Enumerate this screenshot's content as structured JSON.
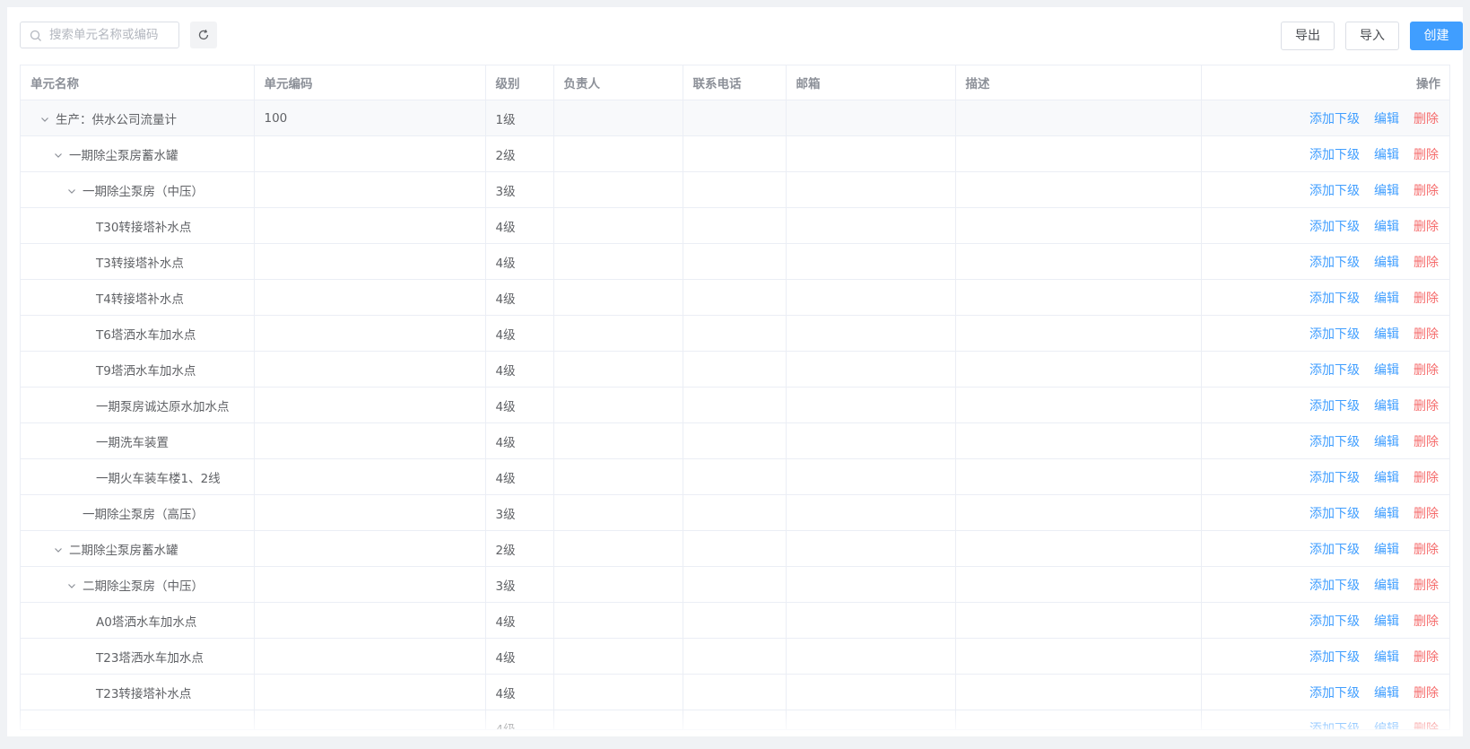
{
  "toolbar": {
    "search_placeholder": "搜索单元名称或编码",
    "export_label": "导出",
    "import_label": "导入",
    "create_label": "创建"
  },
  "table": {
    "columns": [
      "单元名称",
      "单元编码",
      "级别",
      "负责人",
      "联系电话",
      "邮箱",
      "描述",
      "操作"
    ],
    "actions": {
      "add_child": "添加下级",
      "edit": "编辑",
      "delete": "删除"
    },
    "rows": [
      {
        "name": "生产：供水公司流量计",
        "code": "100",
        "level": "1级",
        "depth": 0,
        "expandable": true
      },
      {
        "name": "一期除尘泵房蓄水罐",
        "code": "",
        "level": "2级",
        "depth": 1,
        "expandable": true
      },
      {
        "name": "一期除尘泵房（中压）",
        "code": "",
        "level": "3级",
        "depth": 2,
        "expandable": true
      },
      {
        "name": "T30转接塔补水点",
        "code": "",
        "level": "4级",
        "depth": 3,
        "expandable": false
      },
      {
        "name": "T3转接塔补水点",
        "code": "",
        "level": "4级",
        "depth": 3,
        "expandable": false
      },
      {
        "name": "T4转接塔补水点",
        "code": "",
        "level": "4级",
        "depth": 3,
        "expandable": false
      },
      {
        "name": "T6塔洒水车加水点",
        "code": "",
        "level": "4级",
        "depth": 3,
        "expandable": false
      },
      {
        "name": "T9塔洒水车加水点",
        "code": "",
        "level": "4级",
        "depth": 3,
        "expandable": false
      },
      {
        "name": "一期泵房诚达原水加水点",
        "code": "",
        "level": "4级",
        "depth": 3,
        "expandable": false
      },
      {
        "name": "一期洗车装置",
        "code": "",
        "level": "4级",
        "depth": 3,
        "expandable": false
      },
      {
        "name": "一期火车装车楼1、2线",
        "code": "",
        "level": "4级",
        "depth": 3,
        "expandable": false
      },
      {
        "name": "一期除尘泵房（高压）",
        "code": "",
        "level": "3级",
        "depth": 2,
        "expandable": false
      },
      {
        "name": "二期除尘泵房蓄水罐",
        "code": "",
        "level": "2级",
        "depth": 1,
        "expandable": true
      },
      {
        "name": "二期除尘泵房（中压）",
        "code": "",
        "level": "3级",
        "depth": 2,
        "expandable": true
      },
      {
        "name": "A0塔洒水车加水点",
        "code": "",
        "level": "4级",
        "depth": 3,
        "expandable": false
      },
      {
        "name": "T23塔洒水车加水点",
        "code": "",
        "level": "4级",
        "depth": 3,
        "expandable": false
      },
      {
        "name": "T23转接塔补水点",
        "code": "",
        "level": "4级",
        "depth": 3,
        "expandable": false
      },
      {
        "name": "",
        "code": "",
        "level": "4级",
        "depth": 3,
        "expandable": false
      }
    ]
  }
}
